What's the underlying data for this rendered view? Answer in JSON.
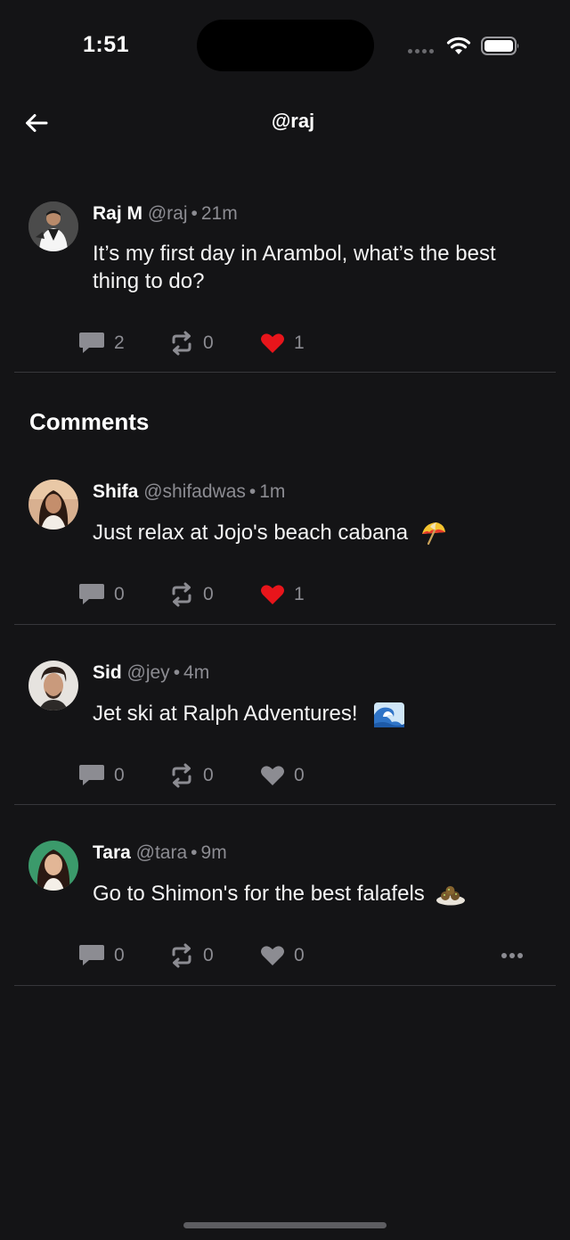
{
  "status_bar": {
    "time": "1:51"
  },
  "nav": {
    "title": "@raj"
  },
  "post": {
    "name": "Raj M",
    "handle": "@raj",
    "separator": "•",
    "ago": "21m",
    "text": "It’s my first day in Arambol, what’s the best thing to do?",
    "comments": "2",
    "reposts": "0",
    "likes": "1",
    "liked": true
  },
  "comments_section": {
    "title": "Comments",
    "items": [
      {
        "name": "Shifa",
        "handle": "@shifadwas",
        "separator": "•",
        "ago": "1m",
        "text": "Just relax at Jojo's beach cabana",
        "emoji": "umbrella-emoji",
        "comments": "0",
        "reposts": "0",
        "likes": "1",
        "liked": true
      },
      {
        "name": "Sid",
        "handle": "@jey",
        "separator": "•",
        "ago": "4m",
        "text": "Jet ski at Ralph Adventures!",
        "emoji": "wave-emoji",
        "comments": "0",
        "reposts": "0",
        "likes": "0",
        "liked": false
      },
      {
        "name": "Tara",
        "handle": "@tara",
        "separator": "•",
        "ago": "9m",
        "text": "Go to Shimon's for the best falafels",
        "emoji": "falafel-emoji",
        "comments": "0",
        "reposts": "0",
        "likes": "0",
        "liked": false
      }
    ]
  },
  "colors": {
    "background": "#141416",
    "like_active": "#e8151b",
    "muted": "#8c8c92",
    "divider": "#37373b"
  }
}
